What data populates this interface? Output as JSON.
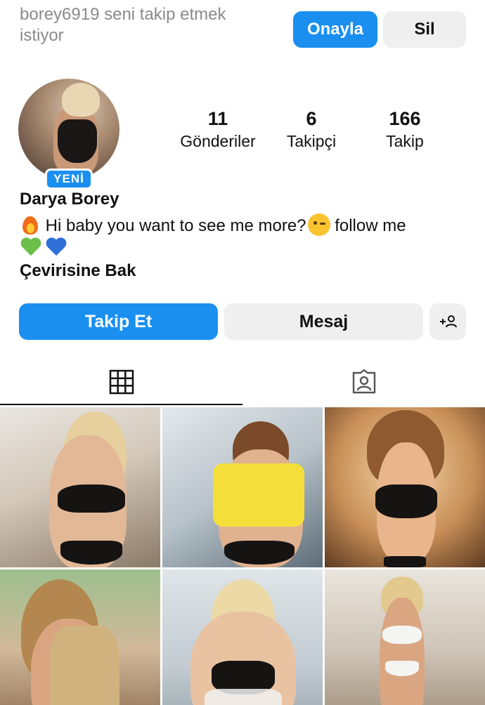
{
  "follow_request": {
    "text": "borey6919 seni takip etmek istiyor",
    "confirm_label": "Onayla",
    "delete_label": "Sil"
  },
  "profile": {
    "badge": "YENİ",
    "name": "Darya Borey",
    "bio": "Hi baby you want to see me more?",
    "bio_follow": " follow me",
    "translate_label": "Çevirisine Bak"
  },
  "stats": {
    "posts": {
      "value": "11",
      "label": "Gönderiler"
    },
    "followers": {
      "value": "6",
      "label": "Takipçi"
    },
    "following": {
      "value": "166",
      "label": "Takip"
    }
  },
  "actions": {
    "follow_label": "Takip Et",
    "message_label": "Mesaj"
  },
  "tabs": {
    "active": "grid",
    "items": [
      {
        "name": "grid",
        "icon": "grid-icon"
      },
      {
        "name": "tagged",
        "icon": "tagged-icon"
      }
    ]
  },
  "colors": {
    "accent": "#1a8ff0",
    "secondary_button": "#efefef"
  }
}
